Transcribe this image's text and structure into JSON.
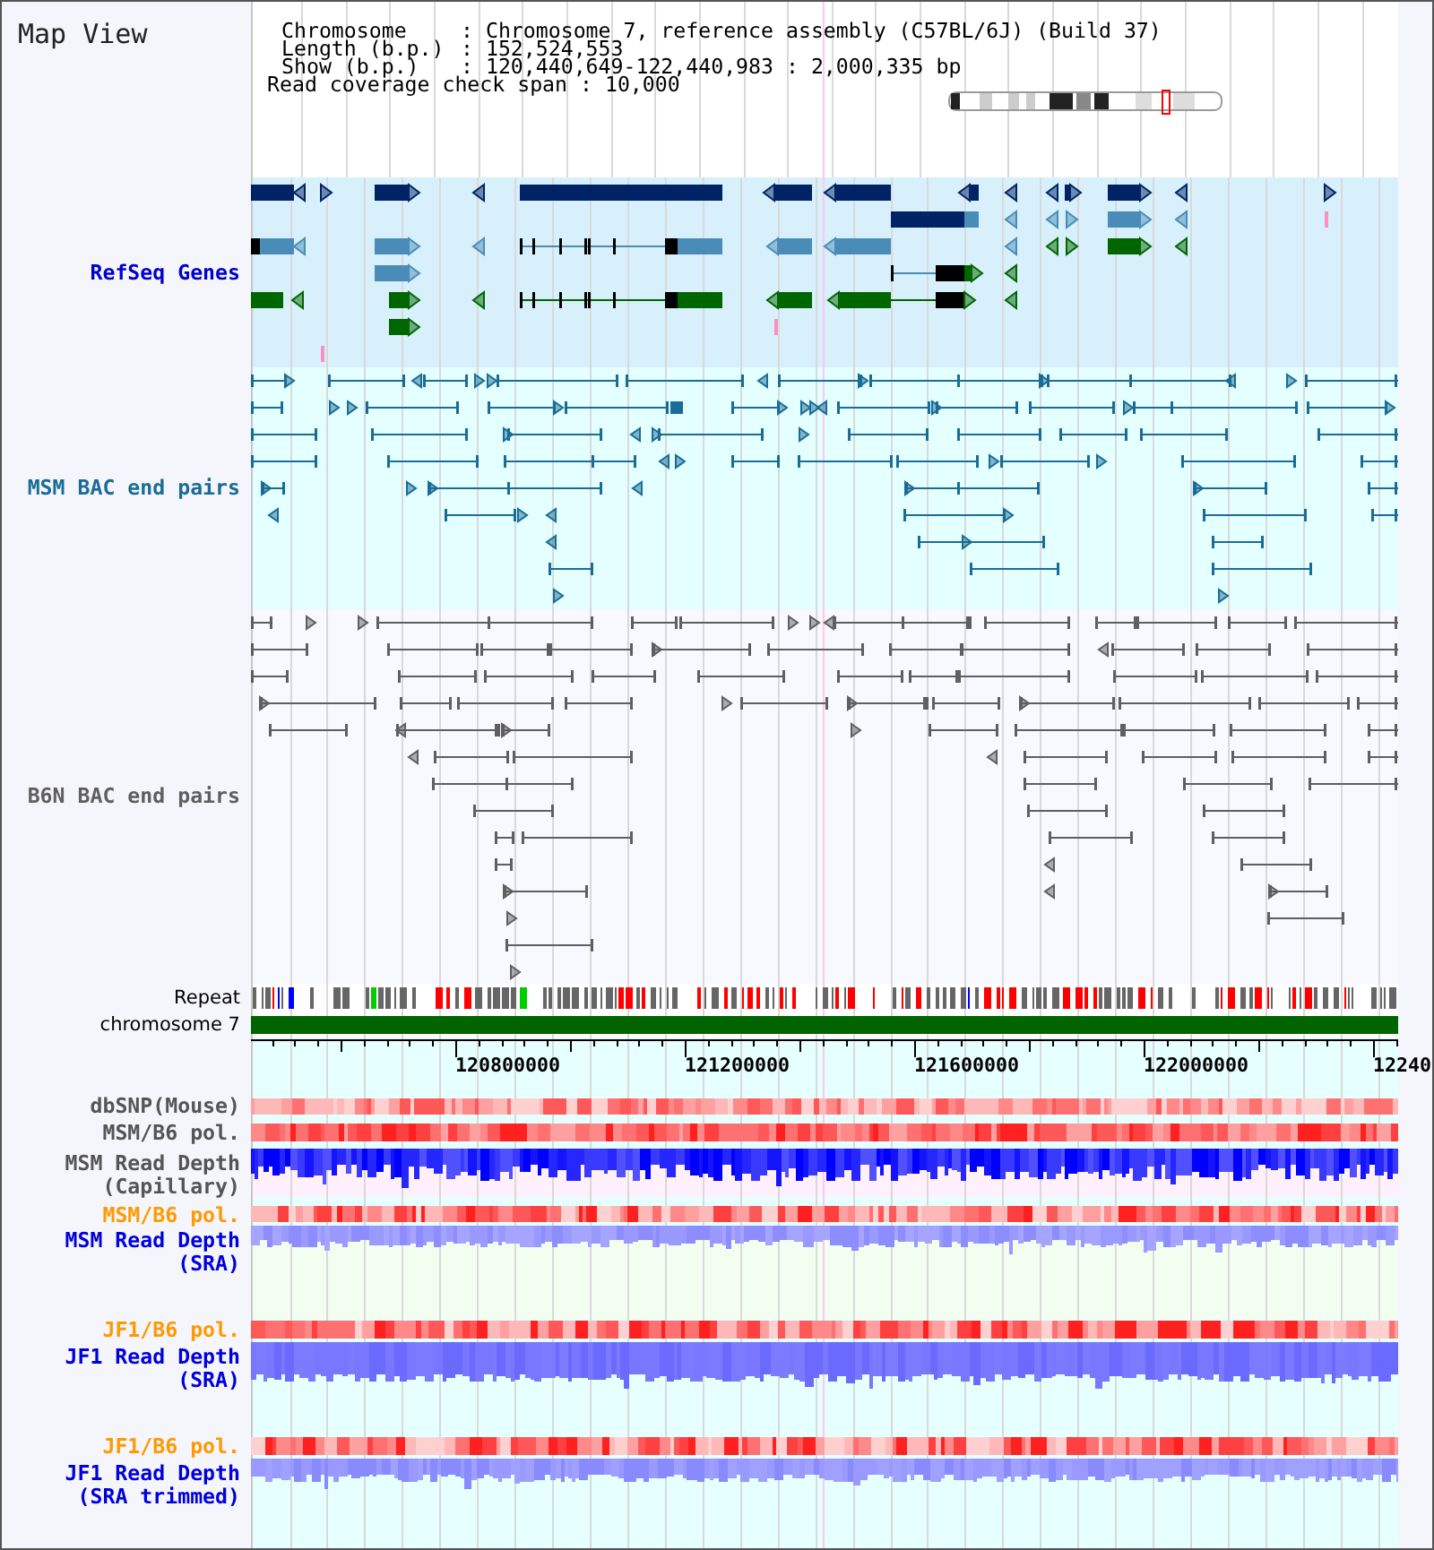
{
  "panel": {
    "title": "Map View"
  },
  "info": {
    "separator": ":",
    "lines": [
      {
        "kind": "aligned",
        "label": "Chromosome",
        "value": "Chromosome 7, reference assembly (C57BL/6J) (Build 37)"
      },
      {
        "kind": "aligned",
        "label": "Length (b.p.)",
        "value": "152,524,553"
      },
      {
        "kind": "aligned",
        "label": "Show (b.p.)",
        "value": "120,440,649-122,440,983 : 2,000,335 bp"
      },
      {
        "kind": "plain",
        "label": "Read coverage check span",
        "value": "10,000"
      }
    ]
  },
  "feature_tracks": [
    {
      "name": "RefSeq Genes",
      "color": "#0000cc",
      "kind": "genes"
    },
    {
      "name": "MSM BAC end pairs",
      "color": "#1a6c96",
      "kind": "pairs"
    },
    {
      "name": "B6N BAC end pairs",
      "color": "#5f5f5f",
      "kind": "pairs"
    }
  ],
  "repeat_track": {
    "name": "Repeat"
  },
  "chromosome_track": {
    "name": "chromosome 7"
  },
  "axis": {
    "tick_labels": [
      "120800000",
      "121200000",
      "121600000",
      "122000000",
      "12240"
    ]
  },
  "data_tracks": [
    {
      "name": "dbSNP(Mouse)",
      "color": "#555555",
      "kind": "heatmap"
    },
    {
      "name": "MSM/B6 pol.",
      "color": "#555555",
      "kind": "heatmap"
    },
    {
      "name": "MSM Read Depth (Capillary)",
      "color": "#555555",
      "kind": "depth"
    },
    {
      "name": "MSM/B6 pol.",
      "color": "#ff9900",
      "kind": "heatmap"
    },
    {
      "name": "MSM Read Depth (SRA)",
      "color": "#0000dd",
      "kind": "depth"
    },
    {
      "name": "JF1/B6 pol.",
      "color": "#ff9900",
      "kind": "heatmap"
    },
    {
      "name": "JF1 Read Depth (SRA)",
      "color": "#0000dd",
      "kind": "depth"
    },
    {
      "name": "JF1/B6 pol.",
      "color": "#ff9900",
      "kind": "heatmap"
    },
    {
      "name": "JF1 Read Depth (SRA trimmed)",
      "color": "#0000dd",
      "kind": "depth"
    }
  ]
}
